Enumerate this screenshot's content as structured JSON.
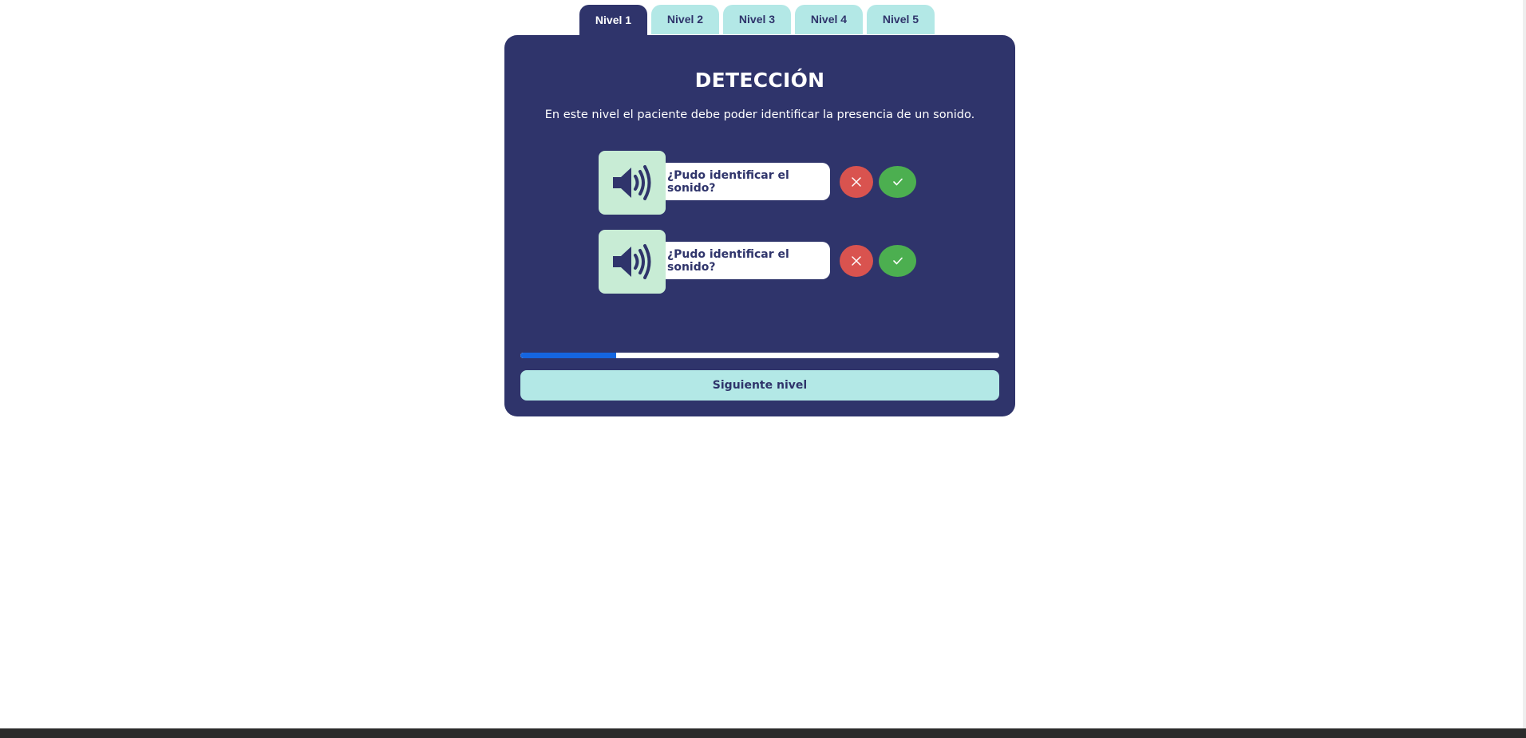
{
  "tabs": [
    {
      "label": "Nivel 1",
      "active": true
    },
    {
      "label": "Nivel 2",
      "active": false
    },
    {
      "label": "Nivel 3",
      "active": false
    },
    {
      "label": "Nivel 4",
      "active": false
    },
    {
      "label": "Nivel 5",
      "active": false
    }
  ],
  "panel": {
    "title": "DETECCIÓN",
    "description": "En este nivel el paciente debe poder identificar la presencia de un sonido.",
    "items": [
      {
        "icon": "speaker-icon",
        "question": "¿Pudo identificar el sonido?",
        "no_icon": "close-icon",
        "yes_icon": "check-icon"
      },
      {
        "icon": "speaker-icon",
        "question": "¿Pudo identificar el sonido?",
        "no_icon": "close-icon",
        "yes_icon": "check-icon"
      }
    ],
    "progress_percent": 20,
    "next_label": "Siguiente nivel"
  },
  "colors": {
    "panel_bg": "#2f346b",
    "tab_bg": "#b3e8e6",
    "speaker_bg": "#c8ecd5",
    "no_button": "#d9534f",
    "yes_button": "#4caf50",
    "progress_fill": "#1565e0"
  }
}
